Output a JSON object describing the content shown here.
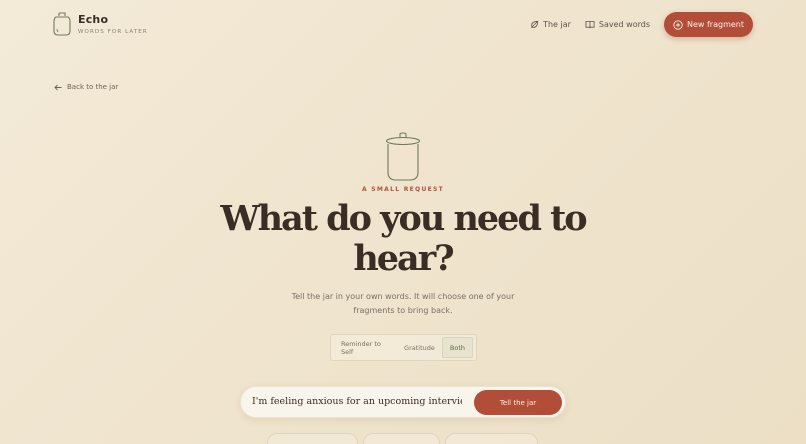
{
  "brand": {
    "name": "Echo",
    "tagline": "WORDS FOR LATER"
  },
  "nav": {
    "jar": "The jar",
    "saved": "Saved words",
    "new_fragment": "New fragment"
  },
  "back_link": "Back to the jar",
  "hero": {
    "kicker": "A SMALL REQUEST",
    "headline": "What do you need to hear?",
    "subtitle": "Tell the jar in your own words. It will choose one of your fragments to bring back."
  },
  "segments": [
    {
      "label": "Reminder to Self",
      "active": false
    },
    {
      "label": "Gratitude",
      "active": false
    },
    {
      "label": "Both",
      "active": true
    }
  ],
  "prompt": {
    "value": "I'm feeling anxious for an upcoming interview",
    "submit_label": "Tell the jar"
  },
  "colors": {
    "accent": "#b24d37",
    "background": "#f0e5cf",
    "active_segment": "#5c6a46"
  }
}
